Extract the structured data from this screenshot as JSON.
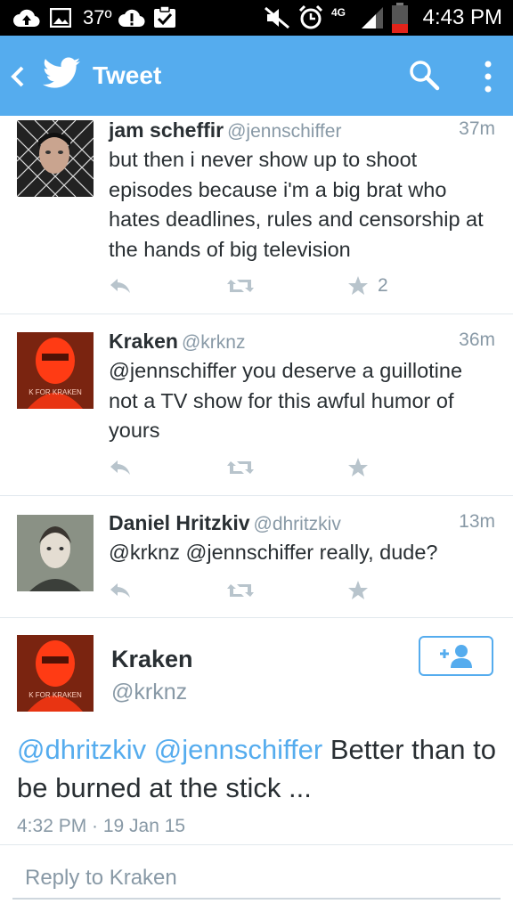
{
  "status_bar": {
    "temperature": "37º",
    "network": "4G",
    "time": "4:43 PM",
    "icons": [
      "upload-icon",
      "image-icon",
      "alert-icon",
      "checklist-icon",
      "mute-icon",
      "alarm-icon",
      "signal-icon",
      "battery-icon"
    ]
  },
  "header": {
    "title": "Tweet",
    "icons": [
      "back-icon",
      "twitter-bird-icon",
      "search-icon",
      "overflow-menu-icon"
    ]
  },
  "tweets": [
    {
      "name": "jam scheffir",
      "handle": "@jennschiffer",
      "time": "37m",
      "text": "but then i never show up to shoot episodes because i'm a big brat who hates deadlines, rules and censorship at the hands of big television",
      "fav_count": "2"
    },
    {
      "name": "Kraken",
      "handle": "@krknz",
      "time": "36m",
      "text": "@jennschiffer you deserve a guillotine not a TV show for this awful humor of yours",
      "avatar_text": "K FOR KRAKEN"
    },
    {
      "name": "Daniel Hritzkiv",
      "handle": "@dhritzkiv",
      "time": "13m",
      "text": "@krknz @jennschiffer really, dude?"
    }
  ],
  "detail": {
    "name": "Kraken",
    "handle": "@krknz",
    "avatar_text": "K FOR KRAKEN",
    "mention_1": "@dhritzkiv",
    "mention_2": "@jennschiffer",
    "text": "Better than to be burned at the stick ...",
    "timestamp": "4:32 PM · 19 Jan 15"
  },
  "reply": {
    "placeholder": "Reply to Kraken"
  },
  "colors": {
    "brand": "#55acee",
    "text": "#292f33",
    "muted": "#8899a6",
    "divider": "#e1e8ed"
  }
}
